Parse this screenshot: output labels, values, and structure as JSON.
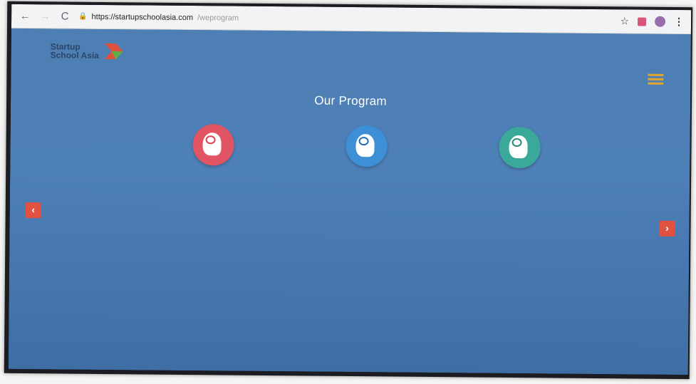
{
  "browser": {
    "url_host": "https://startupschoolasia.com",
    "url_path": "/weprogram",
    "back_icon": "←",
    "forward_icon": "→",
    "reload_icon": "C",
    "star_icon": "☆",
    "menu_icon": "⋮"
  },
  "header": {
    "logo_line1": "Startup",
    "logo_line2": "School Asia"
  },
  "main": {
    "title": "Our Program",
    "subtitle": "",
    "programs": [
      {
        "label_line1": "",
        "label_line2": "",
        "color": "#e05463",
        "brain_color": "#d94050"
      },
      {
        "label_line1": "",
        "label_line2": "",
        "color": "#3d8fd6",
        "brain_color": "#1f6fb8"
      },
      {
        "label_line1": "",
        "label_line2": "",
        "color": "#3aa99a",
        "brain_color": "#2a8a7c"
      }
    ],
    "paragraphs": [
      "",
      "",
      "",
      "",
      ""
    ]
  },
  "carousel": {
    "prev_label": "‹",
    "next_label": "›"
  }
}
